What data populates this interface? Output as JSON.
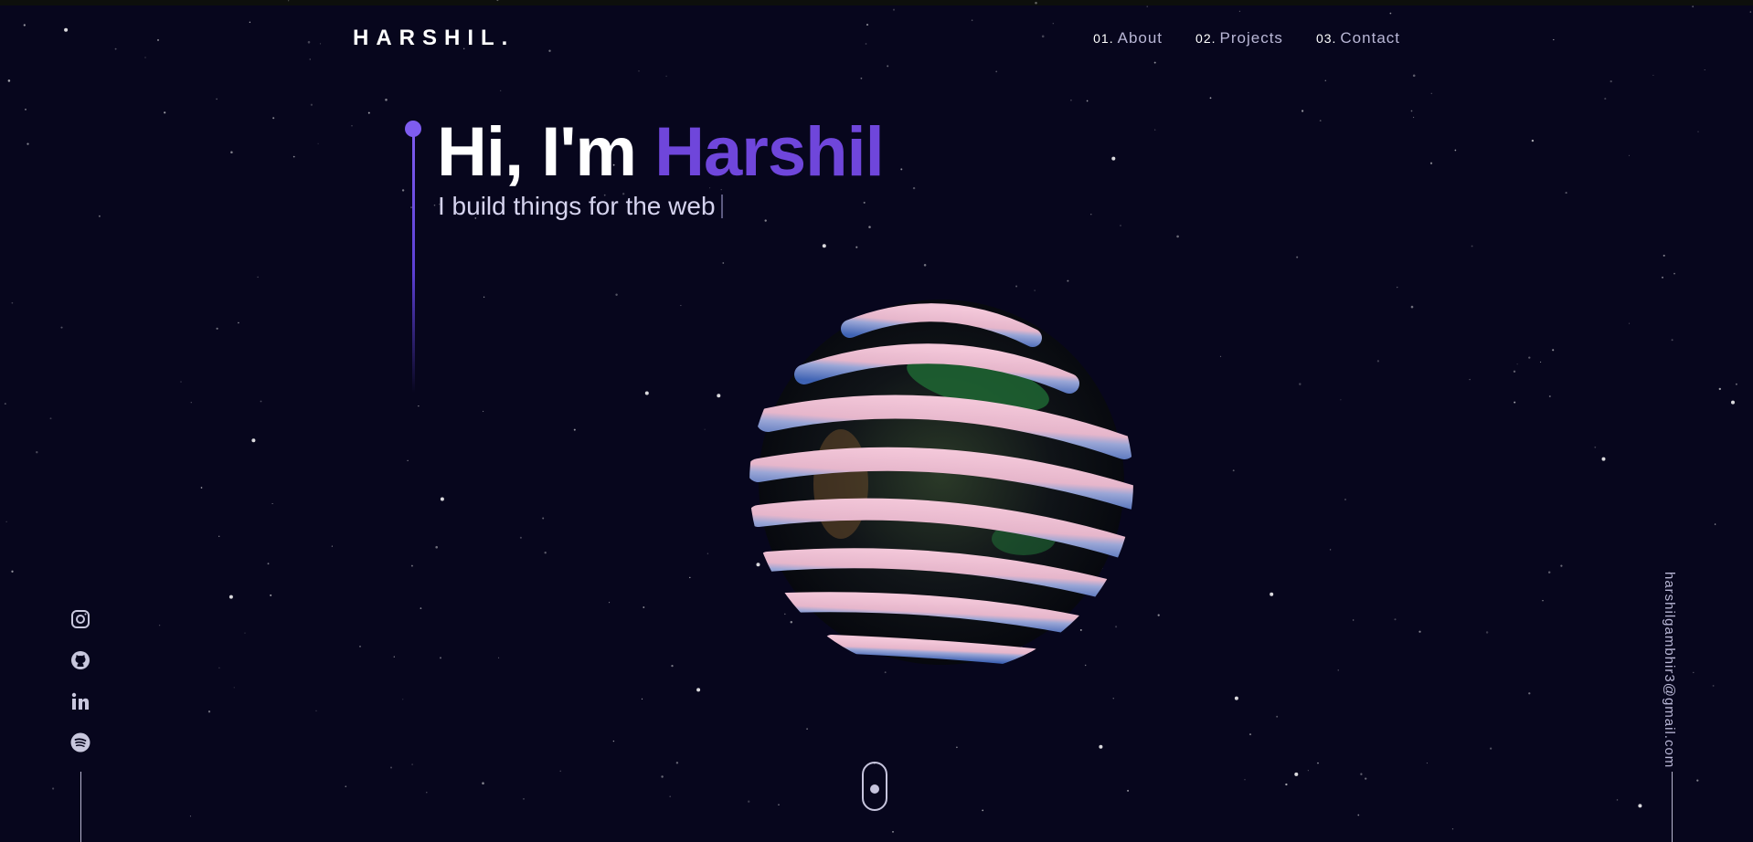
{
  "header": {
    "logo": "HARSHIL.",
    "nav": [
      {
        "num": "01.",
        "label": "About"
      },
      {
        "num": "02.",
        "label": "Projects"
      },
      {
        "num": "03.",
        "label": "Contact"
      }
    ]
  },
  "hero": {
    "greeting": "Hi, I'm",
    "name": "Harshil",
    "subtitle": "I build things for the web"
  },
  "socials": [
    {
      "icon": "instagram-icon"
    },
    {
      "icon": "github-icon"
    },
    {
      "icon": "linkedin-icon"
    },
    {
      "icon": "spotify-icon"
    }
  ],
  "email": "harshilgambhir3@gmail.com",
  "colors": {
    "background": "#07061d",
    "accent": "#6f46db",
    "text_muted": "#b9b7d6"
  }
}
